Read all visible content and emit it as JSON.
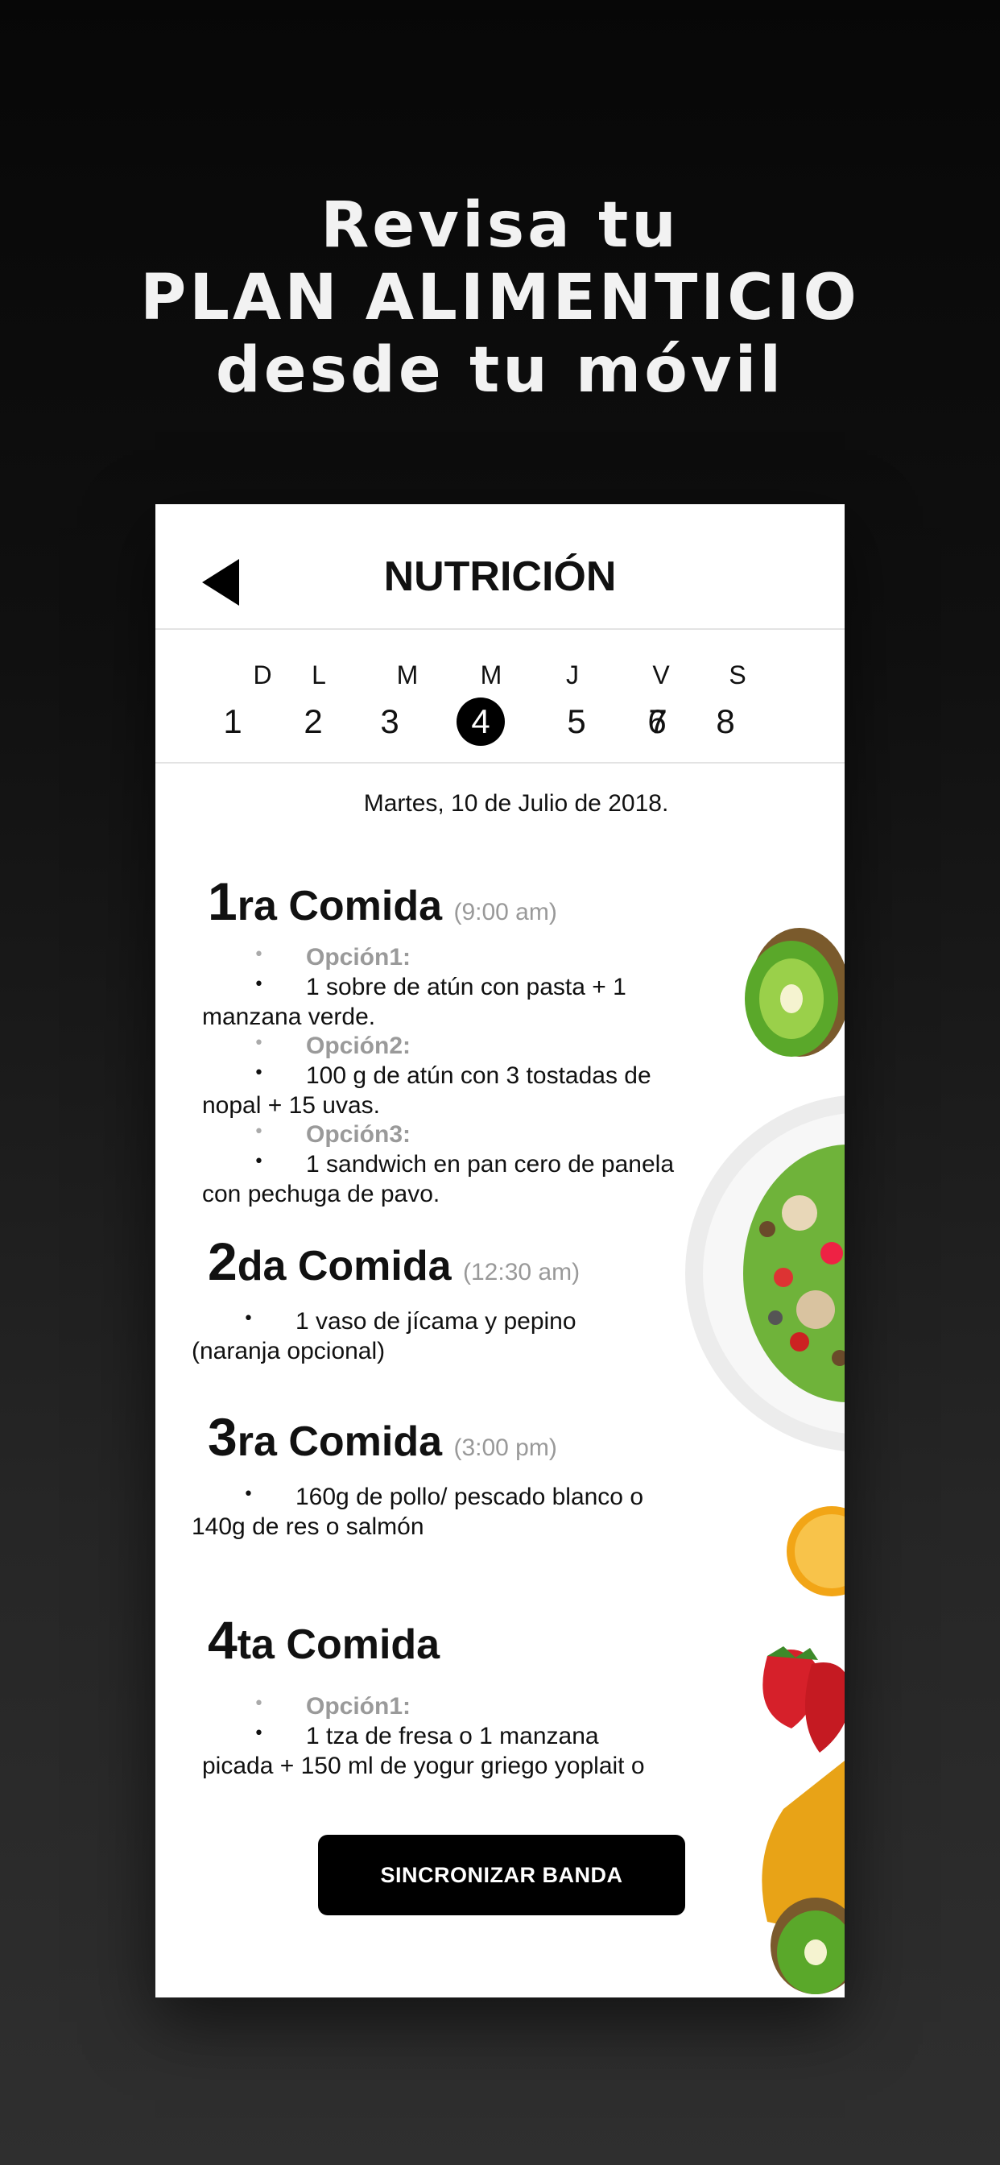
{
  "headline": {
    "line1": "Revisa tu",
    "line2": "PLAN ALIMENTICIO",
    "line3": "desde tu móvil"
  },
  "app": {
    "title": "NUTRICIÓN",
    "back_icon": "back-arrow-icon"
  },
  "week": {
    "days": [
      {
        "letter": "D",
        "number": "1"
      },
      {
        "letter": "L",
        "number": "2"
      },
      {
        "letter": "M",
        "number": "3"
      },
      {
        "letter": "M",
        "number": "4",
        "selected": true
      },
      {
        "letter": "J",
        "number": "5"
      },
      {
        "letter": "V",
        "number": "6"
      },
      {
        "letter": "S",
        "number": "8"
      }
    ],
    "extra_number": "7"
  },
  "date_label": "Martes, 10 de Julio de 2018.",
  "meals": [
    {
      "num": "1",
      "suffix": "ra Comida",
      "time": "(9:00 am)",
      "options": [
        {
          "label": "Opción1:",
          "text_a": "1 sobre de atún con pasta + 1",
          "text_b": "manzana verde."
        },
        {
          "label": "Opción2:",
          "text_a": "100 g de atún con 3 tostadas de",
          "text_b": "nopal + 15 uvas."
        },
        {
          "label": "Opción3:",
          "text_a": "1 sandwich en pan cero de panela",
          "text_b": "con pechuga de pavo."
        }
      ]
    },
    {
      "num": "2",
      "suffix": "da Comida",
      "time": "(12:30 am)",
      "text_a": "1 vaso de jícama y pepino",
      "text_b": "(naranja opcional)"
    },
    {
      "num": "3",
      "suffix": "ra Comida",
      "time": "(3:00 pm)",
      "text_a": "160g de pollo/ pescado blanco o",
      "text_b": "140g de res o salmón"
    },
    {
      "num": "4",
      "suffix": "ta Comida",
      "options": [
        {
          "label": "Opción1:",
          "text_a": "1 tza de fresa o 1 manzana",
          "text_b": "picada + 150 ml de yogur griego yoplait o"
        }
      ]
    }
  ],
  "sync_button": "SINCRONIZAR BANDA",
  "decor": {
    "kiwi_color": "#5aa82a",
    "salad_plate_color": "#f4f4f4",
    "orange_color": "#f2a516",
    "strawberry_color": "#d6202a"
  }
}
